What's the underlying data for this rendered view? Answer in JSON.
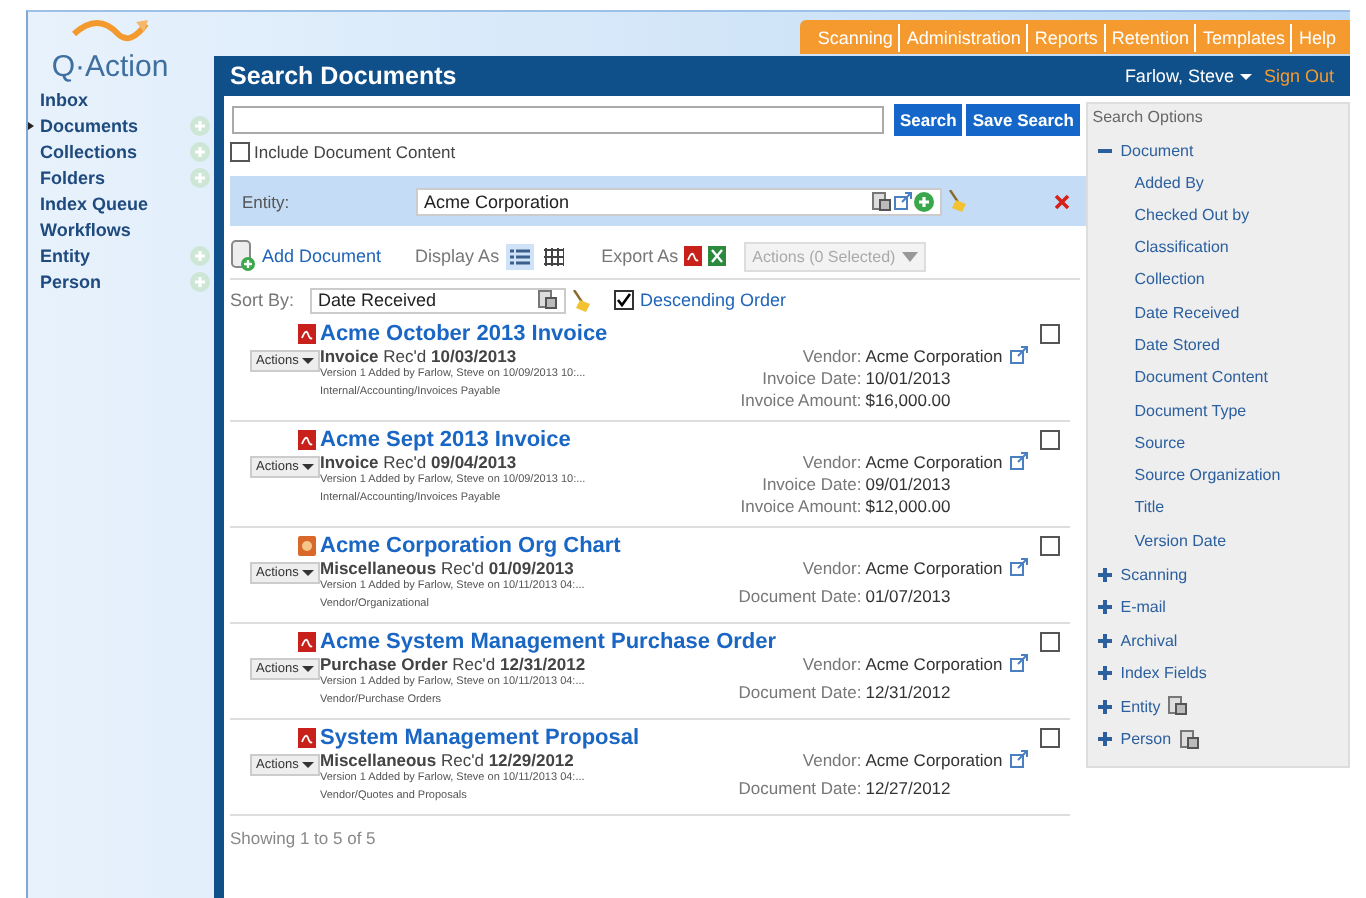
{
  "logo": {
    "text": "Q·Action"
  },
  "top_nav": [
    "Scanning",
    "Administration",
    "Reports",
    "Retention",
    "Templates",
    "Help"
  ],
  "sidebar": {
    "items": [
      {
        "label": "Inbox",
        "selected": false,
        "has_add": false
      },
      {
        "label": "Documents",
        "selected": true,
        "has_add": true
      },
      {
        "label": "Collections",
        "selected": false,
        "has_add": true
      },
      {
        "label": "Folders",
        "selected": false,
        "has_add": true
      },
      {
        "label": "Index Queue",
        "selected": false,
        "has_add": false
      },
      {
        "label": "Workflows",
        "selected": false,
        "has_add": false
      },
      {
        "label": "Entity",
        "selected": false,
        "has_add": true
      },
      {
        "label": "Person",
        "selected": false,
        "has_add": true
      }
    ]
  },
  "header": {
    "title": "Search Documents",
    "user": "Farlow, Steve",
    "sign_out": "Sign Out"
  },
  "search": {
    "buttons": [
      "Search",
      "Save Search"
    ],
    "include_content": {
      "label": "Include Document Content",
      "checked": false
    }
  },
  "entity_filter": {
    "label": "Entity:",
    "value": "Acme Corporation"
  },
  "toolbar": {
    "add": "Add Document",
    "display_label": "Display As",
    "views": [
      {
        "kind": "list",
        "selected": true
      },
      {
        "kind": "grid",
        "selected": false
      }
    ],
    "export_label": "Export As",
    "actions": {
      "label": "Actions (0 Selected)",
      "disabled": true
    }
  },
  "sort": {
    "label": "Sort By:",
    "value": "Date Received",
    "descending": {
      "label": "Descending Order",
      "checked": true
    }
  },
  "documents": [
    {
      "title": "Acme October 2013 Invoice",
      "kind": "pdf",
      "actions": "Actions",
      "type": "Invoice",
      "rec": "Rec'd",
      "date": "10/03/2013",
      "version": "Version 1 Added by Farlow, Steve on 10/09/2013 10:...",
      "path": "Internal/Accounting/Invoices Payable",
      "checked": false,
      "fields": [
        {
          "label": "Vendor:",
          "value": "Acme Corporation"
        },
        {
          "label": "Invoice Date:",
          "value": "10/01/2013"
        },
        {
          "label": "Invoice Amount:",
          "value": "$16,000.00"
        }
      ]
    },
    {
      "title": "Acme Sept 2013 Invoice",
      "kind": "pdf",
      "actions": "Actions",
      "type": "Invoice",
      "rec": "Rec'd",
      "date": "09/04/2013",
      "version": "Version 1 Added by Farlow, Steve on 10/09/2013 10:...",
      "path": "Internal/Accounting/Invoices Payable",
      "checked": false,
      "fields": [
        {
          "label": "Vendor:",
          "value": "Acme Corporation"
        },
        {
          "label": "Invoice Date:",
          "value": "09/01/2013"
        },
        {
          "label": "Invoice Amount:",
          "value": "$12,000.00"
        }
      ]
    },
    {
      "title": "Acme Corporation Org Chart",
      "kind": "image",
      "actions": "Actions",
      "type": "Miscellaneous",
      "rec": "Rec'd",
      "date": "01/09/2013",
      "version": "Version 1 Added by Farlow, Steve on 10/11/2013 04:...",
      "path": "Vendor/Organizational",
      "checked": false,
      "fields": [
        {
          "label": "Vendor:",
          "value": "Acme Corporation"
        },
        {
          "label": "Document Date:",
          "value": "01/07/2013"
        }
      ]
    },
    {
      "title": "Acme System Management Purchase Order",
      "kind": "pdf",
      "actions": "Actions",
      "type": "Purchase Order",
      "rec": "Rec'd",
      "date": "12/31/2012",
      "version": "Version 1 Added by Farlow, Steve on 10/11/2013 04:...",
      "path": "Vendor/Purchase Orders",
      "checked": false,
      "fields": [
        {
          "label": "Vendor:",
          "value": "Acme Corporation"
        },
        {
          "label": "Document Date:",
          "value": "12/31/2012"
        }
      ]
    },
    {
      "title": "System Management Proposal",
      "kind": "pdf",
      "actions": "Actions",
      "type": "Miscellaneous",
      "rec": "Rec'd",
      "date": "12/29/2012",
      "version": "Version 1 Added by Farlow, Steve on 10/11/2013 04:...",
      "path": "Vendor/Quotes and Proposals",
      "checked": false,
      "fields": [
        {
          "label": "Vendor:",
          "value": "Acme Corporation"
        },
        {
          "label": "Document Date:",
          "value": "12/27/2012"
        }
      ]
    }
  ],
  "footer": "Showing 1 to 5 of 5",
  "search_options": {
    "title": "Search Options",
    "groups": [
      {
        "label": "Document",
        "expanded": true,
        "has_lookup": false,
        "children": [
          "Added By",
          "Checked Out by",
          "Classification",
          "Collection",
          "Date Received",
          "Date Stored",
          "Document Content",
          "Document Type",
          "Source",
          "Source Organization",
          "Title",
          "Version Date"
        ]
      },
      {
        "label": "Scanning",
        "expanded": false,
        "has_lookup": false
      },
      {
        "label": "E-mail",
        "expanded": false,
        "has_lookup": false
      },
      {
        "label": "Archival",
        "expanded": false,
        "has_lookup": false
      },
      {
        "label": "Index Fields",
        "expanded": false,
        "has_lookup": false
      },
      {
        "label": "Entity",
        "expanded": false,
        "has_lookup": true
      },
      {
        "label": "Person",
        "expanded": false,
        "has_lookup": true
      }
    ]
  }
}
